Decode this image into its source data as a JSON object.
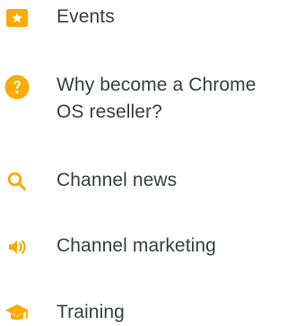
{
  "colors": {
    "accent": "#f9ab00",
    "text": "#3c4043",
    "background": "#ffffff"
  },
  "nav": {
    "items": [
      {
        "label": "Events",
        "icon": "star-ticket-icon"
      },
      {
        "label": "Why become a Chrome OS reseller?",
        "icon": "question-icon"
      },
      {
        "label": "Channel news",
        "icon": "search-icon"
      },
      {
        "label": "Channel marketing",
        "icon": "speaker-icon"
      },
      {
        "label": "Training",
        "icon": "graduation-cap-icon"
      }
    ]
  }
}
